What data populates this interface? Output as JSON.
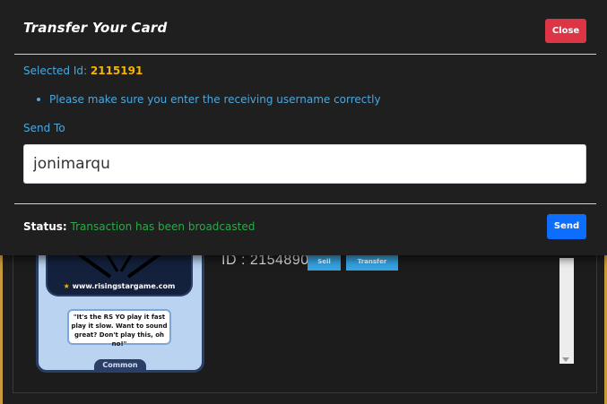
{
  "modal": {
    "title": "Transfer Your Card",
    "close_label": "Close",
    "selected_id_label": "Selected Id:",
    "selected_id_value": "2115191",
    "note": "Please make sure you enter the receiving username correctly",
    "send_to_label": "Send To",
    "username_value": "jonimarqu",
    "status_label": "Status:",
    "status_value": "Transaction has been broadcasted",
    "send_label": "Send"
  },
  "background": {
    "card_id_text": "ID : 2154890",
    "sell_label": "Sell",
    "transfer_label": "Transfer",
    "card": {
      "url": "www.risingstargame.com",
      "quote": "\"It's the RS YO play it fast play it slow. Want to sound great? Don't play this, oh no!\"",
      "rarity": "Common"
    }
  },
  "colors": {
    "accent_blue": "#4aa8e0",
    "id_highlight": "#f4b400",
    "status_green": "#2ea84a",
    "close_red": "#dc3545",
    "send_blue": "#0d6efd"
  }
}
